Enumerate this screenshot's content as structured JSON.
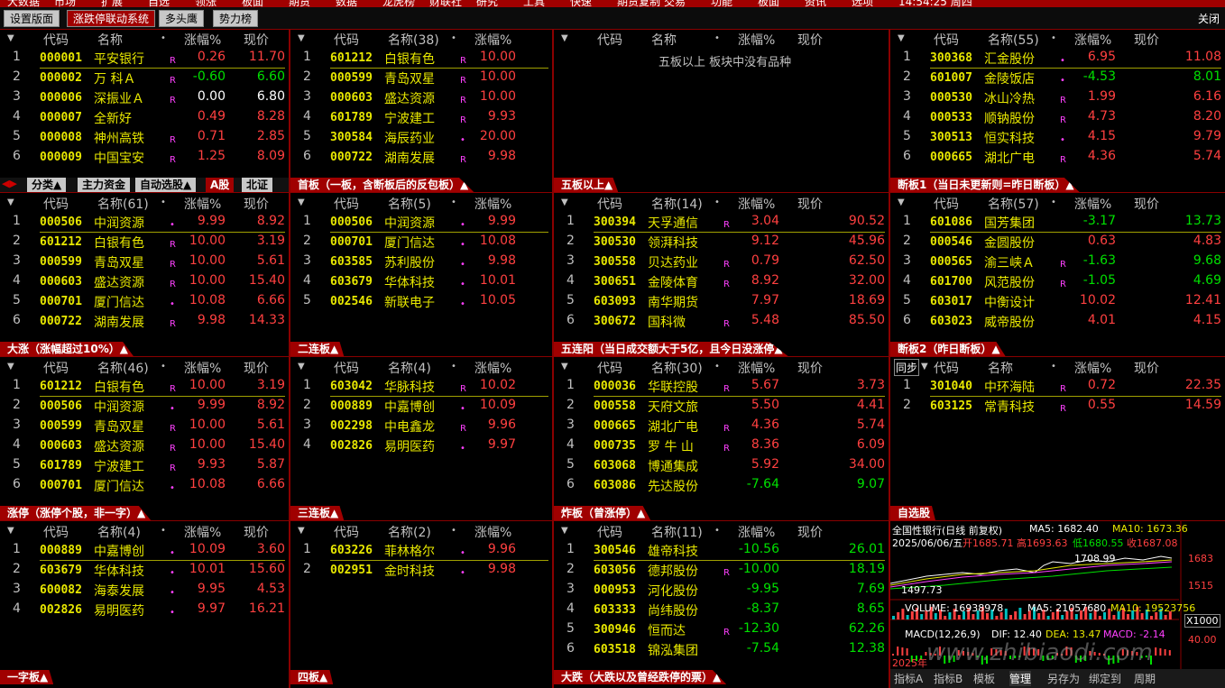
{
  "menubar": [
    "大数据",
    "市场",
    "扩展",
    "自选",
    "领涨",
    "板面",
    "期货",
    "数据",
    "龙虎榜",
    "财联社",
    "研究",
    "工具",
    "快速",
    "期货复制",
    "交易",
    "功能",
    "板面",
    "资讯",
    "选项",
    "14:54:25 周四"
  ],
  "tabs": [
    "设置版面",
    "涨跌停联动系统",
    "多头鹰",
    "势力榜"
  ],
  "close_label": "关闭",
  "colors": {
    "up": "#ff4040",
    "down": "#00e000",
    "code": "#e8e800",
    "accent": "#a00000",
    "flag": "#ff40ff"
  },
  "panels": [
    {
      "headers": [
        "代码",
        "名称",
        "•",
        "涨幅%",
        "现价"
      ],
      "footer": "",
      "nav": [
        "分类▲",
        "主力资金",
        "自动选股▲",
        "A股",
        "北证"
      ],
      "rows": [
        [
          "1",
          "000001",
          "平安银行",
          "R",
          "0.26",
          "11.70",
          "up"
        ],
        [
          "2",
          "000002",
          "万 科Ａ",
          "R",
          "-0.60",
          "6.60",
          "down"
        ],
        [
          "3",
          "000006",
          "深振业Ａ",
          "R",
          "0.00",
          "6.80",
          "flat"
        ],
        [
          "4",
          "000007",
          "全新好",
          "",
          "0.49",
          "8.28",
          "up"
        ],
        [
          "5",
          "000008",
          "神州高铁",
          "R",
          "0.71",
          "2.85",
          "up"
        ],
        [
          "6",
          "000009",
          "中国宝安",
          "R",
          "1.25",
          "8.09",
          "up"
        ]
      ]
    },
    {
      "headers": [
        "代码",
        "名称(38)",
        "•",
        "涨幅%",
        ""
      ],
      "footer": "首板（一板，含断板后的反包板）▲",
      "rows": [
        [
          "1",
          "601212",
          "白银有色",
          "R",
          "10.00",
          "",
          "up"
        ],
        [
          "2",
          "000599",
          "青岛双星",
          "R",
          "10.00",
          "",
          "up"
        ],
        [
          "3",
          "000603",
          "盛达资源",
          "R",
          "10.00",
          "",
          "up"
        ],
        [
          "4",
          "601789",
          "宁波建工",
          "R",
          "9.93",
          "",
          "up"
        ],
        [
          "5",
          "300584",
          "海辰药业",
          "•",
          "20.00",
          "",
          "up"
        ],
        [
          "6",
          "000722",
          "湖南发展",
          "R",
          "9.98",
          "",
          "up"
        ]
      ]
    },
    {
      "headers": [
        "代码",
        "名称",
        "•",
        "涨幅%",
        "现价"
      ],
      "footer": "五板以上▲",
      "message": "五板以上 板块中没有品种",
      "rows": []
    },
    {
      "headers": [
        "代码",
        "名称(55)",
        "•",
        "涨幅%",
        "现价"
      ],
      "footer": "断板1（当日未更新则=昨日断板）▲",
      "rows": [
        [
          "1",
          "300368",
          "汇金股份",
          "•",
          "6.95",
          "11.08",
          "up"
        ],
        [
          "2",
          "601007",
          "金陵饭店",
          "•",
          "-4.53",
          "8.01",
          "down"
        ],
        [
          "3",
          "000530",
          "冰山冷热",
          "R",
          "1.99",
          "6.16",
          "up"
        ],
        [
          "4",
          "000533",
          "顺钠股份",
          "R",
          "4.73",
          "8.20",
          "up"
        ],
        [
          "5",
          "300513",
          "恒实科技",
          "•",
          "4.15",
          "9.79",
          "up"
        ],
        [
          "6",
          "000665",
          "湖北广电",
          "R",
          "4.36",
          "5.74",
          "up"
        ]
      ]
    },
    {
      "headers": [
        "代码",
        "名称(61)",
        "•",
        "涨幅%",
        "现价"
      ],
      "footer": "大涨（涨幅超过10%）▲",
      "rows": [
        [
          "1",
          "000506",
          "中润资源",
          "•",
          "9.99",
          "8.92",
          "up"
        ],
        [
          "2",
          "601212",
          "白银有色",
          "R",
          "10.00",
          "3.19",
          "up"
        ],
        [
          "3",
          "000599",
          "青岛双星",
          "R",
          "10.00",
          "5.61",
          "up"
        ],
        [
          "4",
          "000603",
          "盛达资源",
          "R",
          "10.00",
          "15.40",
          "up"
        ],
        [
          "5",
          "000701",
          "厦门信达",
          "•",
          "10.08",
          "6.66",
          "up"
        ],
        [
          "6",
          "000722",
          "湖南发展",
          "R",
          "9.98",
          "14.33",
          "up"
        ]
      ]
    },
    {
      "headers": [
        "代码",
        "名称(5)",
        "•",
        "涨幅%",
        ""
      ],
      "footer": "二连板▲",
      "rows": [
        [
          "1",
          "000506",
          "中润资源",
          "•",
          "9.99",
          "",
          "up"
        ],
        [
          "2",
          "000701",
          "厦门信达",
          "•",
          "10.08",
          "",
          "up"
        ],
        [
          "3",
          "603585",
          "苏利股份",
          "•",
          "9.98",
          "",
          "up"
        ],
        [
          "4",
          "603679",
          "华体科技",
          "•",
          "10.01",
          "",
          "up"
        ],
        [
          "5",
          "002546",
          "新联电子",
          "•",
          "10.05",
          "",
          "up"
        ]
      ]
    },
    {
      "headers": [
        "代码",
        "名称(14)",
        "•",
        "涨幅%",
        "现价"
      ],
      "footer": "五连阳（当日成交额大于5亿，且今日没涨停▲",
      "rows": [
        [
          "1",
          "300394",
          "天孚通信",
          "R",
          "3.04",
          "90.52",
          "up"
        ],
        [
          "2",
          "300530",
          "领湃科技",
          "",
          "9.12",
          "45.96",
          "up"
        ],
        [
          "3",
          "300558",
          "贝达药业",
          "R",
          "0.79",
          "62.50",
          "up"
        ],
        [
          "4",
          "300651",
          "金陵体育",
          "R",
          "8.92",
          "32.00",
          "up"
        ],
        [
          "5",
          "603093",
          "南华期货",
          "",
          "7.97",
          "18.69",
          "up"
        ],
        [
          "6",
          "300672",
          "国科微",
          "R",
          "5.48",
          "85.50",
          "up"
        ]
      ]
    },
    {
      "headers": [
        "代码",
        "名称(57)",
        "•",
        "涨幅%",
        "现价"
      ],
      "footer": "断板2（昨日断板）▲",
      "rows": [
        [
          "1",
          "601086",
          "国芳集团",
          "",
          "-3.17",
          "13.73",
          "down"
        ],
        [
          "2",
          "000546",
          "金圆股份",
          "",
          "0.63",
          "4.83",
          "up"
        ],
        [
          "3",
          "000565",
          "渝三峡Ａ",
          "R",
          "-1.63",
          "9.68",
          "down"
        ],
        [
          "4",
          "601700",
          "风范股份",
          "R",
          "-1.05",
          "4.69",
          "down"
        ],
        [
          "5",
          "603017",
          "中衡设计",
          "",
          "10.02",
          "12.41",
          "up"
        ],
        [
          "6",
          "603023",
          "威帝股份",
          "",
          "4.01",
          "4.15",
          "up"
        ]
      ]
    },
    {
      "headers": [
        "代码",
        "名称(46)",
        "•",
        "涨幅%",
        "现价"
      ],
      "footer": "涨停（涨停个股，非一字）▲",
      "rows": [
        [
          "1",
          "601212",
          "白银有色",
          "R",
          "10.00",
          "3.19",
          "up"
        ],
        [
          "2",
          "000506",
          "中润资源",
          "•",
          "9.99",
          "8.92",
          "up"
        ],
        [
          "3",
          "000599",
          "青岛双星",
          "R",
          "10.00",
          "5.61",
          "up"
        ],
        [
          "4",
          "000603",
          "盛达资源",
          "R",
          "10.00",
          "15.40",
          "up"
        ],
        [
          "5",
          "601789",
          "宁波建工",
          "R",
          "9.93",
          "5.87",
          "up"
        ],
        [
          "6",
          "000701",
          "厦门信达",
          "•",
          "10.08",
          "6.66",
          "up"
        ]
      ]
    },
    {
      "headers": [
        "代码",
        "名称(4)",
        "•",
        "涨幅%",
        ""
      ],
      "footer": "三连板▲",
      "rows": [
        [
          "1",
          "603042",
          "华脉科技",
          "R",
          "10.02",
          "",
          "up"
        ],
        [
          "2",
          "000889",
          "中嘉博创",
          "•",
          "10.09",
          "",
          "up"
        ],
        [
          "3",
          "002298",
          "中电鑫龙",
          "R",
          "9.96",
          "",
          "up"
        ],
        [
          "4",
          "002826",
          "易明医药",
          "•",
          "9.97",
          "",
          "up"
        ]
      ]
    },
    {
      "headers": [
        "代码",
        "名称(30)",
        "•",
        "涨幅%",
        "现价"
      ],
      "footer": "炸板（曾涨停）▲",
      "rows": [
        [
          "1",
          "000036",
          "华联控股",
          "R",
          "5.67",
          "3.73",
          "up"
        ],
        [
          "2",
          "000558",
          "天府文旅",
          "",
          "5.50",
          "4.41",
          "up"
        ],
        [
          "3",
          "000665",
          "湖北广电",
          "R",
          "4.36",
          "5.74",
          "up"
        ],
        [
          "4",
          "000735",
          "罗 牛 山",
          "R",
          "8.36",
          "6.09",
          "up"
        ],
        [
          "5",
          "603068",
          "博通集成",
          "",
          "5.92",
          "34.00",
          "up"
        ],
        [
          "6",
          "603086",
          "先达股份",
          "",
          "-7.64",
          "9.07",
          "down"
        ]
      ]
    },
    {
      "headers": [
        "代码",
        "名称",
        "•",
        "涨幅%",
        "现价"
      ],
      "sync": "同步",
      "footer": "自选股",
      "rows": [
        [
          "1",
          "301040",
          "中环海陆",
          "R",
          "0.72",
          "22.35",
          "up"
        ],
        [
          "2",
          "603125",
          "常青科技",
          "R",
          "0.55",
          "14.59",
          "up"
        ]
      ]
    },
    {
      "headers": [
        "代码",
        "名称(4)",
        "•",
        "涨幅%",
        "现价"
      ],
      "footer": "一字板▲",
      "rows": [
        [
          "1",
          "000889",
          "中嘉博创",
          "•",
          "10.09",
          "3.60",
          "up"
        ],
        [
          "2",
          "603679",
          "华体科技",
          "•",
          "10.01",
          "15.60",
          "up"
        ],
        [
          "3",
          "600082",
          "海泰发展",
          "•",
          "9.95",
          "4.53",
          "up"
        ],
        [
          "4",
          "002826",
          "易明医药",
          "•",
          "9.97",
          "16.21",
          "up"
        ]
      ]
    },
    {
      "headers": [
        "代码",
        "名称(2)",
        "•",
        "涨幅%",
        ""
      ],
      "footer": "四板▲",
      "rows": [
        [
          "1",
          "603226",
          "菲林格尔",
          "•",
          "9.96",
          "",
          "up"
        ],
        [
          "2",
          "002951",
          "金时科技",
          "•",
          "9.98",
          "",
          "up"
        ]
      ]
    },
    {
      "headers": [
        "代码",
        "名称(11)",
        "•",
        "涨幅%",
        "现价"
      ],
      "footer": "大跌（大跌以及曾经跌停的票）▲",
      "rows": [
        [
          "1",
          "300546",
          "雄帝科技",
          "",
          "-10.56",
          "26.01",
          "down"
        ],
        [
          "2",
          "603056",
          "德邦股份",
          "R",
          "-10.00",
          "18.19",
          "down"
        ],
        [
          "3",
          "000953",
          "河化股份",
          "",
          "-9.95",
          "7.69",
          "down"
        ],
        [
          "4",
          "603333",
          "尚纬股份",
          "",
          "-8.37",
          "8.65",
          "down"
        ],
        [
          "5",
          "300946",
          "恒而达",
          "R",
          "-12.30",
          "62.26",
          "down"
        ],
        [
          "6",
          "603518",
          "锦泓集团",
          "",
          "-7.54",
          "12.38",
          "down"
        ]
      ]
    }
  ],
  "mini_chart": {
    "title": "全国性银行(日线 前复权)",
    "ma5": "MA5: 1682.40",
    "ma10": "MA10: 1673.36",
    "date": "2025/06/06/五",
    "open": "开1685.71",
    "high": "高1693.63",
    "low": "低1680.55",
    "close": "收1687.08",
    "peak_label": "1708.99",
    "low_label": "1497.73",
    "price_ticks": [
      "1683",
      "1515"
    ],
    "volume_line": "VOLUME: 16938978",
    "vol_ma5": "MA5: 21057680",
    "vol_ma10": "MA10: 19523756",
    "vol_unit": "X1000",
    "macd": "MACD(12,26,9)",
    "dif": "DIF: 12.40",
    "dea": "DEA: 13.47",
    "macd_val": "MACD: -2.14",
    "macd_tick": "40.00",
    "year": "2025年",
    "tabs": [
      "指标A",
      "指标B",
      "模板",
      "管理",
      "另存为",
      "绑定到",
      "周期"
    ]
  },
  "watermark": "www.zhibiaodi.com"
}
